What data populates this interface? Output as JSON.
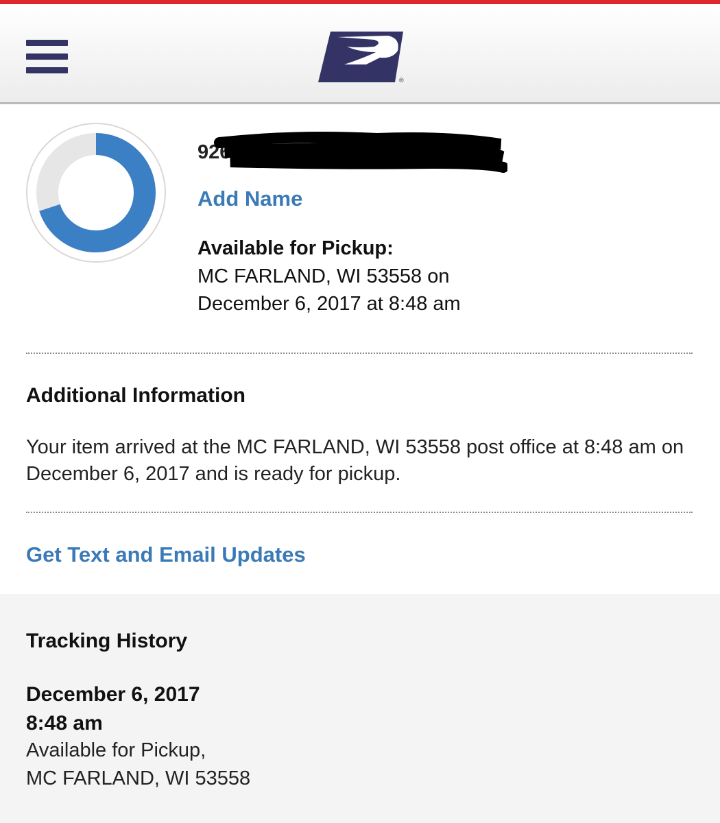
{
  "header": {
    "menu_icon": "hamburger-menu-icon",
    "logo_icon": "usps-eagle-logo",
    "logo_mark": "®",
    "accent_color": "#e0262e",
    "brand_color": "#333366"
  },
  "package": {
    "tracking_number_visible": "926",
    "tracking_number_redacted": true,
    "add_name_label": "Add Name",
    "progress_ring_fraction": 0.7,
    "status_title": "Available for Pickup:",
    "status_location": "MC FARLAND, WI 53558 on",
    "status_datetime": "December 6, 2017 at 8:48 am"
  },
  "additional_info": {
    "title": "Additional Information",
    "text": "Your item arrived at the MC FARLAND, WI 53558 post office at 8:48 am on December 6, 2017 and is ready for pickup."
  },
  "updates": {
    "link_label": "Get Text and Email Updates"
  },
  "tracking_history": {
    "title": "Tracking History",
    "events": [
      {
        "date": "December 6, 2017",
        "time": "8:48 am",
        "status": "Available for Pickup,",
        "location": "MC FARLAND, WI 53558"
      }
    ]
  },
  "colors": {
    "link": "#3a7ab6",
    "ring_progress": "#3b7fc4",
    "ring_track": "#e6e6e6"
  }
}
